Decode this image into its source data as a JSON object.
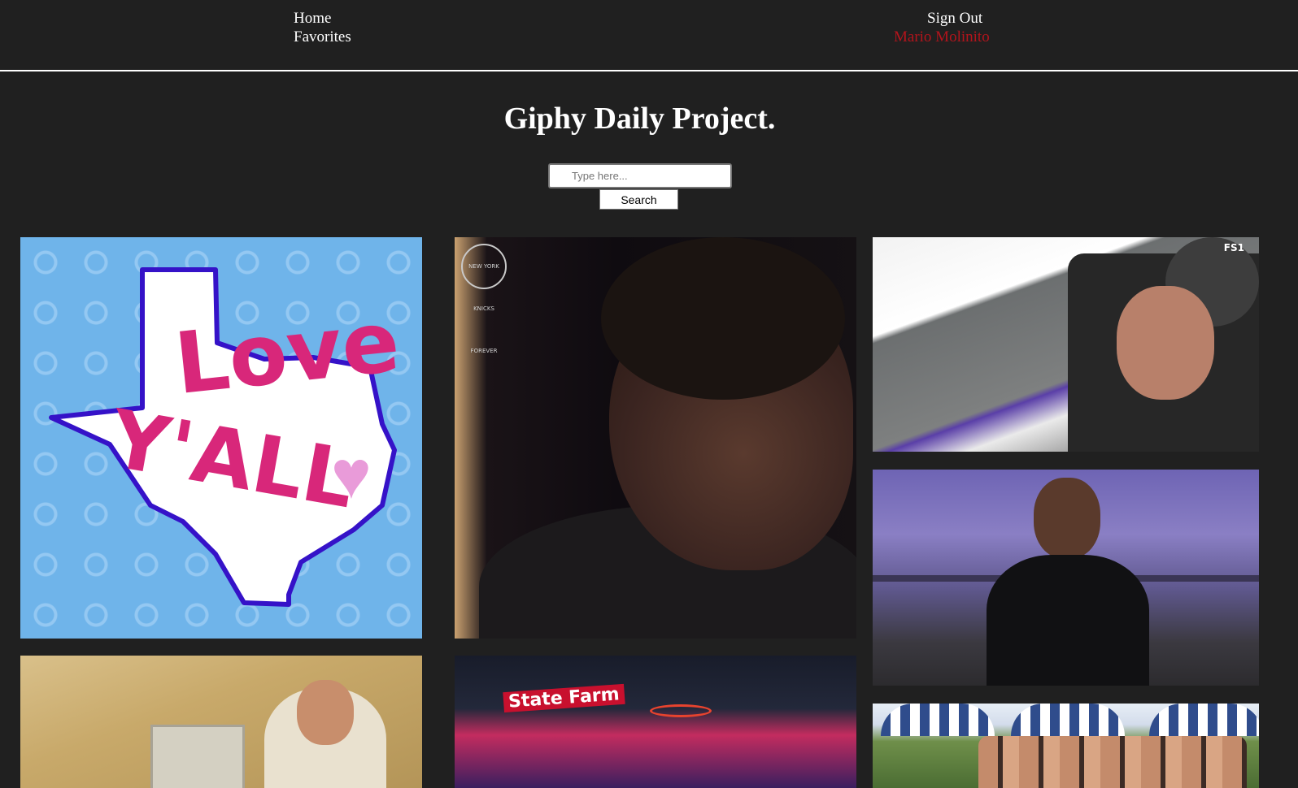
{
  "nav": {
    "home": "Home",
    "favorites": "Favorites",
    "sign_out": "Sign Out",
    "user_name": "Mario Molinito"
  },
  "header": {
    "title": "Giphy Daily Project."
  },
  "search": {
    "placeholder": "Type here...",
    "value": "",
    "button_label": "Search"
  },
  "gifs": {
    "love_yall": {
      "line1": "Love",
      "line2": "Y'ALL",
      "heart": "♥"
    },
    "knicks": {
      "logo_text": "NEW YORK KNICKS FOREVER"
    },
    "race": {
      "network": "FS1"
    },
    "court": {
      "sponsor": "State Farm"
    }
  },
  "colors": {
    "background": "#202020",
    "text": "#ffffff",
    "user_accent": "#b3141c"
  }
}
